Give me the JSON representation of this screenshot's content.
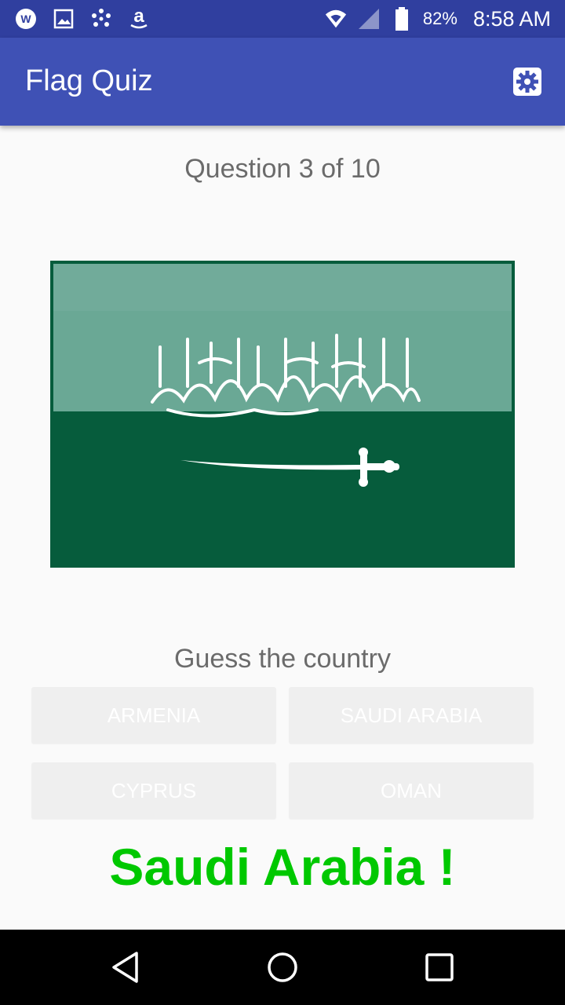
{
  "status_bar": {
    "left_icons": [
      "wifi-calling-icon",
      "gallery-icon",
      "dots-app-icon",
      "amazon-icon"
    ],
    "battery_percent": "82%",
    "time": "8:58 AM"
  },
  "app_bar": {
    "title": "Flag Quiz",
    "settings_icon": "settings-gear-icon"
  },
  "quiz": {
    "question_label": "Question 3 of 10",
    "flag_colors": {
      "green": "#065c3c",
      "light_green": "#6aa895"
    },
    "prompt": "Guess the country",
    "answers": [
      "ARMENIA",
      "SAUDI ARABIA",
      "CYPRUS",
      "OMAN"
    ],
    "result": "Saudi Arabia !",
    "result_color": "#00c800"
  },
  "nav_bar": {
    "back_icon": "back-triangle-icon",
    "home_icon": "home-circle-icon",
    "recents_icon": "recents-square-icon"
  }
}
